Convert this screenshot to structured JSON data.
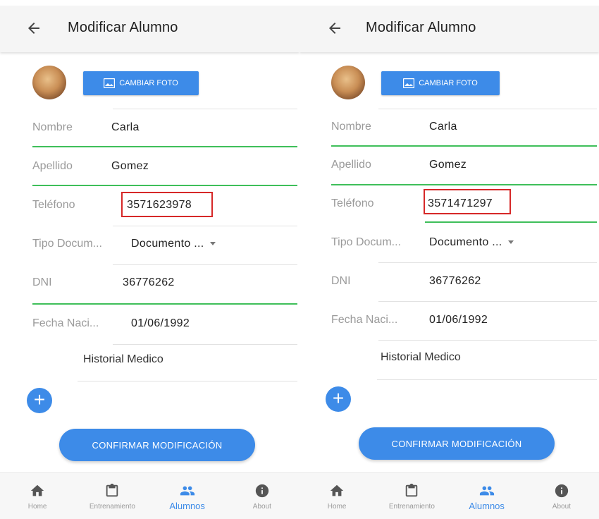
{
  "screens": [
    {
      "header": {
        "title": "Modificar Alumno"
      },
      "photo_button": {
        "label": "CAMBIAR FOTO"
      },
      "fields": {
        "nombre": {
          "label": "Nombre",
          "value": "Carla"
        },
        "apellido": {
          "label": "Apellido",
          "value": "Gomez"
        },
        "telefono": {
          "label": "Teléfono",
          "value": "3571623978"
        },
        "tipo_documento": {
          "label": "Tipo Docum...",
          "value": "Documento ..."
        },
        "dni": {
          "label": "DNI",
          "value": "36776262"
        },
        "fecha_nacimiento": {
          "label": "Fecha Naci...",
          "value": "01/06/1992"
        }
      },
      "historial": {
        "label": "Historial Medico"
      },
      "fab": {
        "symbol": "+"
      },
      "confirm_button": {
        "label": "CONFIRMAR MODIFICACIÓN"
      },
      "nav": [
        {
          "label": "Home",
          "icon": "home-icon"
        },
        {
          "label": "Entrenamiento",
          "icon": "clipboard-icon"
        },
        {
          "label": "Alumnos",
          "icon": "people-icon",
          "active": true
        },
        {
          "label": "About",
          "icon": "info-icon"
        }
      ]
    },
    {
      "header": {
        "title": "Modificar Alumno"
      },
      "photo_button": {
        "label": "CAMBIAR FOTO"
      },
      "fields": {
        "nombre": {
          "label": "Nombre",
          "value": "Carla"
        },
        "apellido": {
          "label": "Apellido",
          "value": "Gomez"
        },
        "telefono": {
          "label": "Teléfono",
          "value": "3571471297"
        },
        "tipo_documento": {
          "label": "Tipo Docum...",
          "value": "Documento ..."
        },
        "dni": {
          "label": "DNI",
          "value": "36776262"
        },
        "fecha_nacimiento": {
          "label": "Fecha Naci...",
          "value": "01/06/1992"
        }
      },
      "historial": {
        "label": "Historial Medico"
      },
      "fab": {
        "symbol": "+"
      },
      "confirm_button": {
        "label": "CONFIRMAR MODIFICACIÓN"
      },
      "nav": [
        {
          "label": "Home",
          "icon": "home-icon"
        },
        {
          "label": "Entrenamiento",
          "icon": "clipboard-icon"
        },
        {
          "label": "Alumnos",
          "icon": "people-icon",
          "active": true
        },
        {
          "label": "About",
          "icon": "info-icon"
        }
      ]
    }
  ],
  "colors": {
    "accent": "#3d8be8",
    "field_underline": "#3fbf5a",
    "highlight_box": "#d62828",
    "label_gray": "#9a9a9a"
  }
}
